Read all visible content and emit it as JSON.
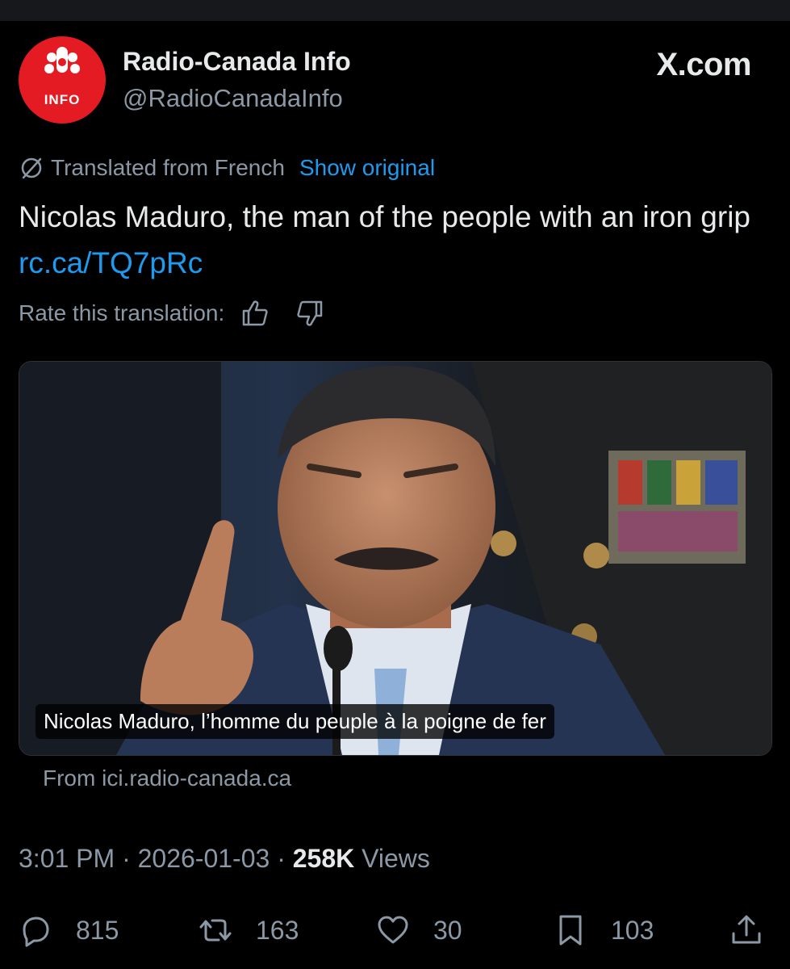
{
  "header": {
    "avatar_label": "INFO",
    "display_name": "Radio-Canada Info",
    "handle": "@RadioCanadaInfo",
    "brand": "X.com"
  },
  "translation": {
    "translated_from": "Translated from French",
    "show_original": "Show original",
    "rate_label": "Rate this translation:"
  },
  "tweet": {
    "text": "Nicolas Maduro, the man of the people with an iron grip ",
    "link": "rc.ca/TQ7pRc"
  },
  "card": {
    "caption": "Nicolas Maduro, l’homme du peuple à la poigne de fer",
    "source": "From ici.radio-canada.ca"
  },
  "meta": {
    "time": "3:01 PM",
    "separator": " · ",
    "date": "2026-01-03",
    "views_count": "258K",
    "views_label": " Views"
  },
  "actions": {
    "replies": "815",
    "reposts": "163",
    "likes": "30",
    "bookmarks": "103"
  },
  "colors": {
    "background": "#000000",
    "link_blue": "#1d9bf0",
    "muted_gray": "#8b98a5",
    "brand_red": "#e41b23"
  },
  "icons": [
    "cbc-gem-logo",
    "translate-icon",
    "thumbs-up-icon",
    "thumbs-down-icon",
    "reply-icon",
    "repost-icon",
    "like-icon",
    "bookmark-icon",
    "share-icon"
  ]
}
